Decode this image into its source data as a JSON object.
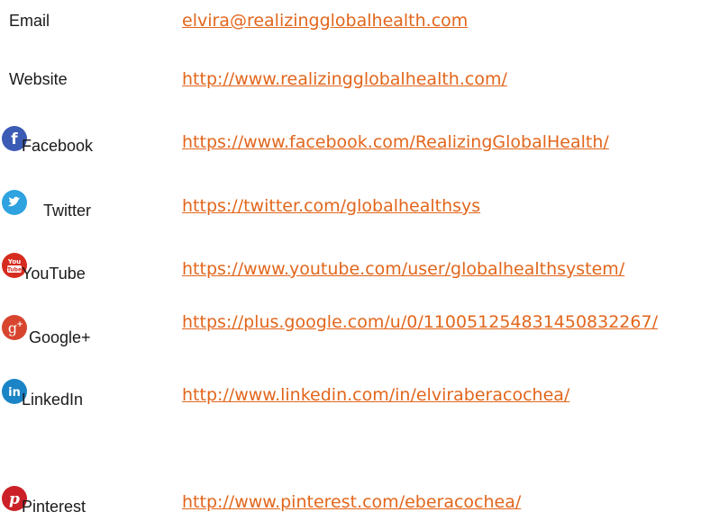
{
  "contacts": [
    {
      "label": "Email",
      "value": "elvira@realizingglobalhealth.com",
      "icon": "",
      "color": ""
    },
    {
      "label": "Website",
      "value": "http://www.realizingglobalhealth.com/",
      "icon": "",
      "color": ""
    },
    {
      "label": "Facebook",
      "value": "https://www.facebook.com/RealizingGlobalHealth/",
      "icon": "facebook-icon",
      "color": "#3b5bb5"
    },
    {
      "label": "Twitter",
      "value": "https://twitter.com/globalhealthsys",
      "icon": "twitter-icon",
      "color": "#2ea3e0"
    },
    {
      "label": "YouTube",
      "value": "https://www.youtube.com/user/globalhealthsystem/",
      "icon": "youtube-icon",
      "color": "#d62c1f"
    },
    {
      "label": "Google+",
      "value": "https://plus.google.com/u/0/110051254831450832267/",
      "icon": "google-plus-icon",
      "color": "#d8452f"
    },
    {
      "label": "LinkedIn",
      "value": "http://www.linkedin.com/in/elviraberacochea/",
      "icon": "linkedin-icon",
      "color": "#1b84c6"
    },
    {
      "label": "Pinterest",
      "value": "http://www.pinterest.com/eberacochea/",
      "icon": "pinterest-icon",
      "color": "#cb2027"
    }
  ],
  "link_color": "#e2661c"
}
